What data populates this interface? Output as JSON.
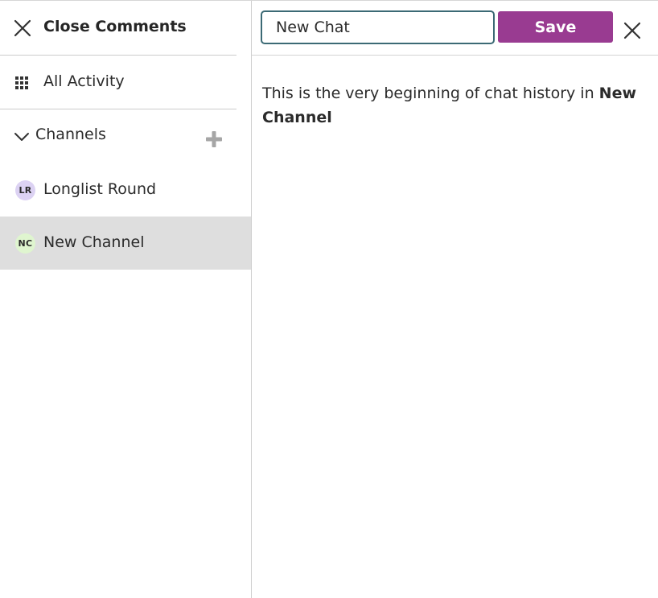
{
  "sidebar": {
    "close_label": "Close Comments",
    "activity_label": "All Activity",
    "channels_label": "Channels",
    "channels": [
      {
        "initials": "LR",
        "name": "Longlist Round",
        "avatar_color": "#dcd2f3",
        "selected": false
      },
      {
        "initials": "NC",
        "name": "New Channel",
        "avatar_color": "#dff5cf",
        "selected": true
      }
    ]
  },
  "main": {
    "name_input_value": "New Chat",
    "save_label": "Save",
    "history_text": "This is the very beginning of chat history in",
    "history_channel": "New Channel"
  },
  "colors": {
    "accent": "#993b91",
    "input_border": "#3c6a75",
    "selected_bg": "#dedede"
  },
  "icons": {
    "close": "close-icon",
    "activity": "grid-icon",
    "expand": "chevron-down-icon",
    "add": "plus-icon"
  }
}
